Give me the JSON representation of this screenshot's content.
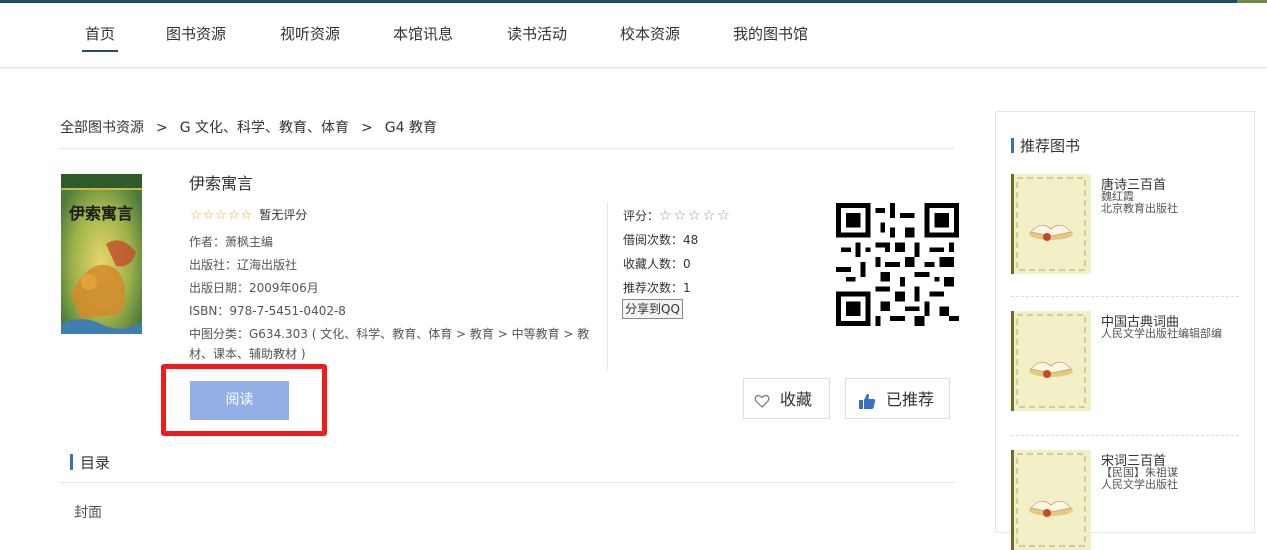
{
  "nav": {
    "items": [
      "首页",
      "图书资源",
      "视听资源",
      "本馆讯息",
      "读书活动",
      "校本资源",
      "我的图书馆"
    ],
    "active": "首页"
  },
  "breadcrumb": [
    "全部图书资源",
    "G 文化、科学、教育、体育",
    "G4 教育"
  ],
  "breadcrumb_sep": ">",
  "book": {
    "title": "伊索寓言",
    "cover_text": "伊索寓言",
    "rating_text": "暂无评分",
    "author": "作者：萧枫主编",
    "publisher": "出版社：辽海出版社",
    "pub_date": "出版日期：2009年06月",
    "isbn": "ISBN：978-7-5451-0402-8",
    "classification": "中图分类：G634.303 ( 文化、科学、教育、体育 > 教育 > 中等教育 > 教材、课本、辅助教材 )"
  },
  "stats": {
    "score_label": "评分：",
    "borrow": "借阅次数：48",
    "favorites": "收藏人数：0",
    "recommends": "推荐次数：1",
    "share": "分享到QQ"
  },
  "actions": {
    "read": "阅读",
    "favorite": "收藏",
    "recommended": "已推荐"
  },
  "toc": {
    "title": "目录",
    "items": [
      "封面"
    ]
  },
  "sidebar": {
    "title": "推荐图书",
    "books": [
      {
        "title": "唐诗三百首",
        "author": "魏红霞",
        "publisher": "北京教育出版社"
      },
      {
        "title": "中国古典词曲",
        "author": "人民文学出版社编辑部编",
        "publisher": ""
      },
      {
        "title": "宋词三百首",
        "author": "【民国】朱祖谋",
        "publisher": "人民文学出版社"
      }
    ]
  },
  "colors": {
    "accent": "#3a6fc4",
    "read_button": "#93b0e6",
    "highlight_box": "#ee1c1c",
    "star": "#f5a623"
  }
}
